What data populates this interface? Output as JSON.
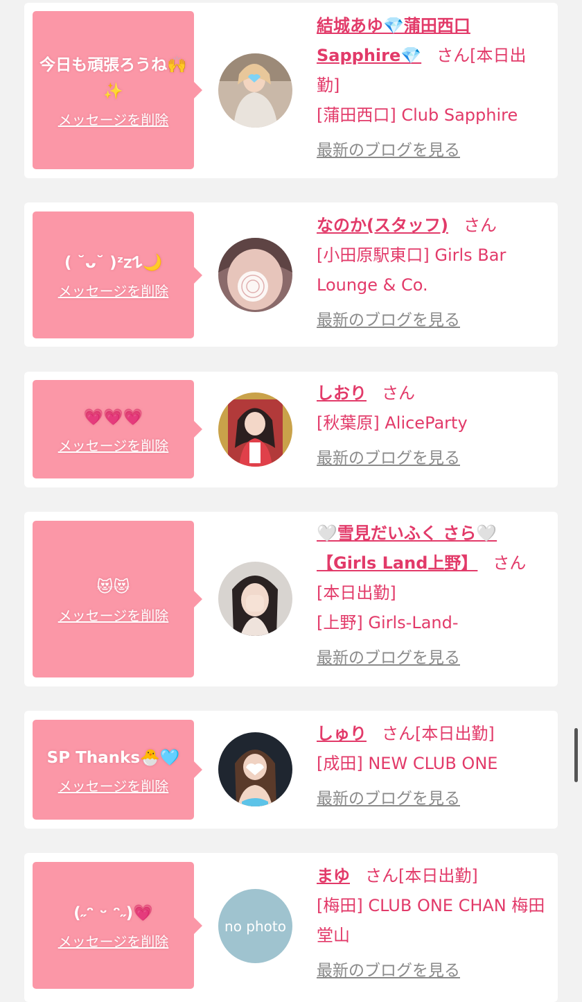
{
  "delete_label": "メッセージを削除",
  "blog_label": "最新のブログを見る",
  "san_label": "さん",
  "cards": [
    {
      "message": "今日も頑張ろうね🙌✨",
      "name": "結城あゆ💎蒲田西口Sapphire💎",
      "after_san": "[本日出勤]",
      "shop": "[蒲田西口] Club Sapphire"
    },
    {
      "message": "( ˘ᴗ˘ )ᶻ𝗓𐰁🌙",
      "name": "なのか(スタッフ)",
      "after_san": "",
      "shop": "[小田原駅東口] Girls Bar Lounge & Co."
    },
    {
      "message": "💗💗💗",
      "name": "しおり",
      "after_san": "",
      "shop": "[秋葉原] AliceParty"
    },
    {
      "message": "😻😻",
      "name": "🤍雪見だいふく さら🤍【Girls Land上野】",
      "after_san": "",
      "status": "[本日出勤]",
      "shop": "[上野] Girls-Land-"
    },
    {
      "message": "SP Thanks🐣🩵",
      "name": "しゅり",
      "after_san": "[本日出勤]",
      "shop": "[成田] NEW CLUB ONE"
    },
    {
      "message": "(˶ᵔ ᵕ ᵔ˶)💗",
      "name": "まゆ",
      "after_san": "[本日出勤]",
      "shop": "[梅田] CLUB ONE CHAN 梅田堂山",
      "avatar_text": "no photo"
    }
  ],
  "colors": {
    "bubble": "#fb97a7",
    "accent": "#e23a69",
    "card_bg": "#ffffff",
    "page_bg": "#f2f2f2"
  }
}
